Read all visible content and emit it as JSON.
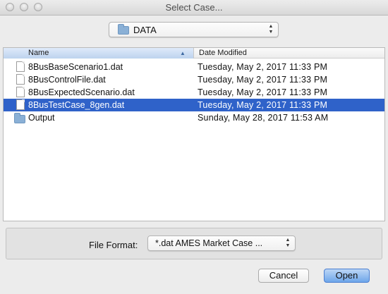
{
  "window": {
    "title": "Select Case..."
  },
  "location": {
    "selected": "DATA",
    "icon": "folder-icon"
  },
  "columns": {
    "name": "Name",
    "date_modified": "Date Modified"
  },
  "files": [
    {
      "name": "8BusBaseScenario1.dat",
      "date": "Tuesday, May 2, 2017 11:33 PM",
      "kind": "file",
      "selected": false
    },
    {
      "name": "8BusControlFile.dat",
      "date": "Tuesday, May 2, 2017 11:33 PM",
      "kind": "file",
      "selected": false
    },
    {
      "name": "8BusExpectedScenario.dat",
      "date": "Tuesday, May 2, 2017 11:33 PM",
      "kind": "file",
      "selected": false
    },
    {
      "name": "8BusTestCase_8gen.dat",
      "date": "Tuesday, May 2, 2017 11:33 PM",
      "kind": "file",
      "selected": true
    },
    {
      "name": "Output",
      "date": "Sunday, May 28, 2017 11:53 AM",
      "kind": "folder",
      "selected": false
    }
  ],
  "file_format": {
    "label": "File Format:",
    "selected": "*.dat AMES Market Case ..."
  },
  "buttons": {
    "cancel": "Cancel",
    "open": "Open"
  },
  "colors": {
    "selection": "#2f62c9",
    "default_button": "#6ea6ea"
  }
}
